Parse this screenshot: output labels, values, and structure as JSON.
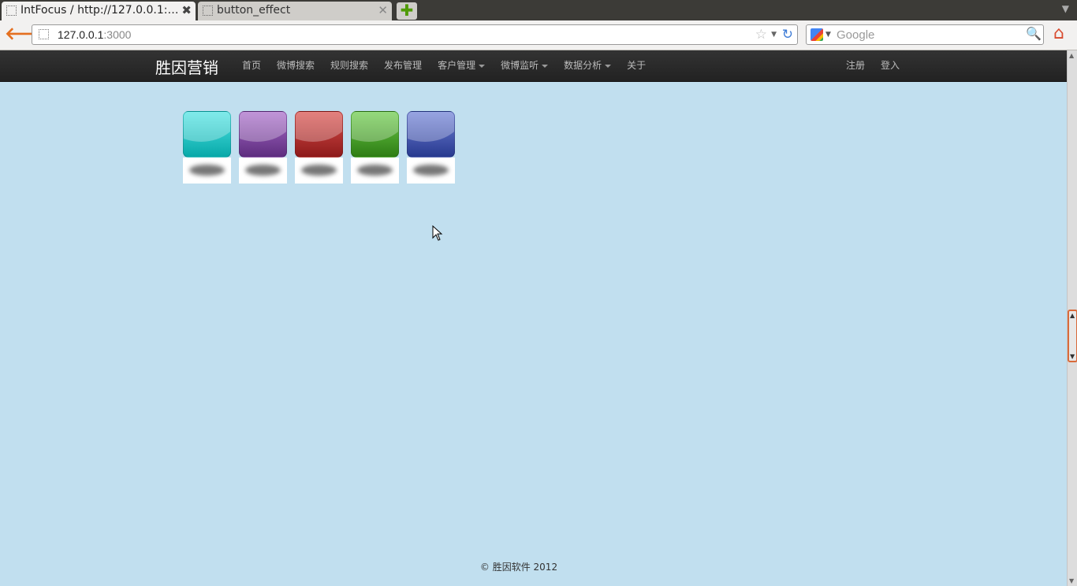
{
  "browser": {
    "tabs": [
      {
        "title": "IntFocus / http://127.0.0.1:…",
        "close": "✖",
        "active": true
      },
      {
        "title": "button_effect",
        "close": "✕",
        "active": false
      }
    ],
    "new_tab": "✚",
    "address": {
      "host": "127.0.0.1",
      "port": ":3000"
    },
    "search": {
      "engine": "Google",
      "placeholder": "Google"
    }
  },
  "site": {
    "brand": "胜因营销",
    "nav_left": [
      {
        "label": "首页",
        "dropdown": false
      },
      {
        "label": "微博搜索",
        "dropdown": false
      },
      {
        "label": "规则搜索",
        "dropdown": false
      },
      {
        "label": "发布管理",
        "dropdown": false
      },
      {
        "label": "客户管理",
        "dropdown": true
      },
      {
        "label": "微博监听",
        "dropdown": true
      },
      {
        "label": "数据分析",
        "dropdown": true
      },
      {
        "label": "关于",
        "dropdown": false
      }
    ],
    "nav_right": [
      {
        "label": "注册"
      },
      {
        "label": "登入"
      }
    ],
    "buttons": [
      {
        "color": "cyan",
        "top": "#4fe3e3",
        "bottom": "#08a9a9"
      },
      {
        "color": "purple",
        "top": "#a86cc9",
        "bottom": "#5e2d7f"
      },
      {
        "color": "red",
        "top": "#d9504c",
        "bottom": "#8e1a1a"
      },
      {
        "color": "green",
        "top": "#6ccb4a",
        "bottom": "#2e7d14"
      },
      {
        "color": "blue",
        "top": "#6f80d6",
        "bottom": "#283a8f"
      }
    ],
    "footer": "© 胜因软件 2012"
  }
}
